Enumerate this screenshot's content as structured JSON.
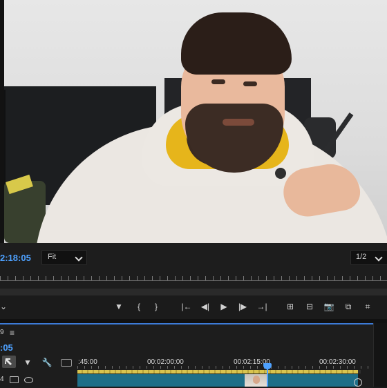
{
  "program_monitor": {
    "timecode": "2:18:05",
    "zoom_select": "Fit",
    "resolution_select": "1/2",
    "transport": {
      "marker": "▼",
      "mark_in": "{",
      "mark_out": "}",
      "go_to_in": "|←",
      "step_back": "◀|",
      "play": "▶",
      "step_forward": "|▶",
      "go_to_out": "→|",
      "lift": "⊞",
      "extract": "⊟",
      "export_frame": "📷",
      "compare": "⧉",
      "settings": "⌗"
    }
  },
  "timeline": {
    "sequence_suffix": "9",
    "menu_icon": "≡",
    "timecode": ":05",
    "ruler": {
      "labels": [
        ":45:00",
        "00:02:00:00",
        "00:02:15:00",
        "00:02:30:00"
      ]
    },
    "track": {
      "label": "4",
      "icons": [
        "film-icon",
        "eye-icon"
      ]
    },
    "tools": [
      "selection-tool",
      "marker-tool",
      "wrench-tool",
      "captions-tool"
    ]
  },
  "colors": {
    "accent_blue": "#4ea1ff",
    "clip_teal": "#1f6f88",
    "work_area_yellow": "#d9c44f",
    "panel_bg": "#1d1d1d"
  }
}
